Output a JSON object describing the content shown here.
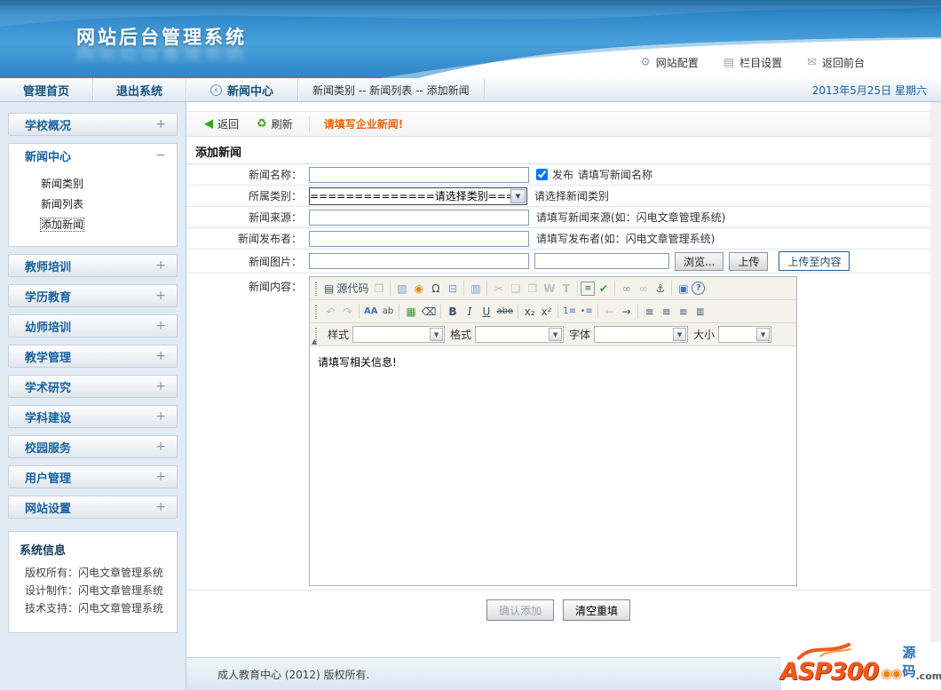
{
  "colors": {
    "header_blue": "#2f86c8",
    "accent_navy": "#17629e",
    "message_orange": "#e8650a",
    "logo_orange": "#f4581c",
    "logo_blue": "#2b6bb0",
    "sidebar_bg": "#e0ebf4"
  },
  "header": {
    "title": "网站后台管理系统",
    "links": [
      {
        "label": "网站配置",
        "icon": "⚙"
      },
      {
        "label": "栏目设置",
        "icon": "▤"
      },
      {
        "label": "返回前台",
        "icon": "✉"
      }
    ]
  },
  "navbar": {
    "home": "管理首页",
    "logout": "退出系统",
    "section": "新闻中心",
    "section_icon": "‹",
    "breadcrumb": "新闻类别 -- 新闻列表 -- 添加新闻",
    "date": "2013年5月25日 星期六"
  },
  "sidebar": {
    "expand_glyph": "+",
    "collapse_glyph": "−",
    "pill_top": "学校概况",
    "expanded": {
      "label": "新闻中心",
      "items": [
        "新闻类别",
        "新闻列表",
        "添加新闻"
      ]
    },
    "pills_bottom": [
      "教师培训",
      "学历教育",
      "幼师培训",
      "教学管理",
      "学术研究",
      "学科建设",
      "校园服务",
      "用户管理",
      "网站设置"
    ],
    "sysinfo": {
      "title": "系统信息",
      "lines": [
        "版权所有：闪电文章管理系统",
        "设计制作：闪电文章管理系统",
        "技术支持：闪电文章管理系统"
      ]
    }
  },
  "toolbar": {
    "back": "返回",
    "back_icon": "◀",
    "refresh": "刷新",
    "refresh_icon": "♻",
    "message": "请填写企业新闻!"
  },
  "form": {
    "title": "添加新闻",
    "rows": {
      "name": {
        "label": "新闻名称：",
        "value": "",
        "publish": "发布",
        "publish_checked": true,
        "hint": "请填写新闻名称"
      },
      "category": {
        "label": "所属类别：",
        "selected": "==============请选择类别=============",
        "hint": "请选择新闻类别"
      },
      "source": {
        "label": "新闻来源：",
        "value": "",
        "hint": "请填写新闻来源(如：闪电文章管理系统)"
      },
      "publisher": {
        "label": "新闻发布者：",
        "value": "",
        "hint": "请填写发布者(如：闪电文章管理系统)"
      },
      "image": {
        "label": "新闻图片：",
        "value": "",
        "file_value": "",
        "browse": "浏览...",
        "upload": "上传",
        "upload_to_content": "上传至内容"
      },
      "content": {
        "label": "新闻内容：",
        "text": "请填写相关信息!"
      }
    },
    "buttons": {
      "confirm": "确认添加",
      "reset": "清空重填"
    }
  },
  "editor": {
    "row1": [
      {
        "name": "source",
        "glyph": "▤",
        "label": "源代码"
      },
      {
        "name": "preview",
        "glyph": "❐"
      },
      {
        "name": "image",
        "glyph": "▧"
      },
      {
        "name": "media",
        "glyph": "◉"
      },
      {
        "name": "special-char",
        "glyph": "Ω"
      },
      {
        "name": "page-break",
        "glyph": "⊟"
      },
      {
        "name": "template",
        "glyph": "▥"
      },
      {
        "name": "cut",
        "glyph": "✂"
      },
      {
        "name": "copy",
        "glyph": "❑"
      },
      {
        "name": "paste",
        "glyph": "❒"
      },
      {
        "name": "paste-word",
        "glyph": "W"
      },
      {
        "name": "paste-text",
        "glyph": "T"
      },
      {
        "name": "print",
        "glyph": "≡"
      },
      {
        "name": "spell-check",
        "glyph": "✔"
      },
      {
        "name": "link",
        "glyph": "∞"
      },
      {
        "name": "unlink",
        "glyph": "∞"
      },
      {
        "name": "anchor",
        "glyph": "⚓"
      },
      {
        "name": "maximize",
        "glyph": "▣"
      },
      {
        "name": "help",
        "glyph": "?"
      }
    ],
    "row2": [
      {
        "name": "undo",
        "glyph": "↶"
      },
      {
        "name": "redo",
        "glyph": "↷"
      },
      {
        "name": "find",
        "glyph": "AA"
      },
      {
        "name": "replace",
        "glyph": "ab"
      },
      {
        "name": "select-all",
        "glyph": "▦"
      },
      {
        "name": "remove-format",
        "glyph": "⌫"
      },
      {
        "name": "bold",
        "glyph": "B"
      },
      {
        "name": "italic",
        "glyph": "I"
      },
      {
        "name": "underline",
        "glyph": "U"
      },
      {
        "name": "strikethrough",
        "glyph": "abe"
      },
      {
        "name": "subscript",
        "glyph": "x₂"
      },
      {
        "name": "superscript",
        "glyph": "x²"
      },
      {
        "name": "ordered-list",
        "glyph": "1≡"
      },
      {
        "name": "unordered-list",
        "glyph": "•≡"
      },
      {
        "name": "outdent",
        "glyph": "←"
      },
      {
        "name": "indent",
        "glyph": "→"
      },
      {
        "name": "align-left",
        "glyph": "≡"
      },
      {
        "name": "align-center",
        "glyph": "≡"
      },
      {
        "name": "align-right",
        "glyph": "≡"
      },
      {
        "name": "justify",
        "glyph": "≣"
      }
    ],
    "combos": [
      {
        "label": "样式"
      },
      {
        "label": "格式"
      },
      {
        "label": "字体"
      },
      {
        "label": "大小"
      }
    ],
    "collapse_glyph": "▲"
  },
  "footer": {
    "copyright": "成人教育中心 (2012) 版权所有."
  },
  "logo": {
    "text": "ASP300",
    "eyes": "◉◉",
    "cn": "源码",
    "com": ".com"
  }
}
